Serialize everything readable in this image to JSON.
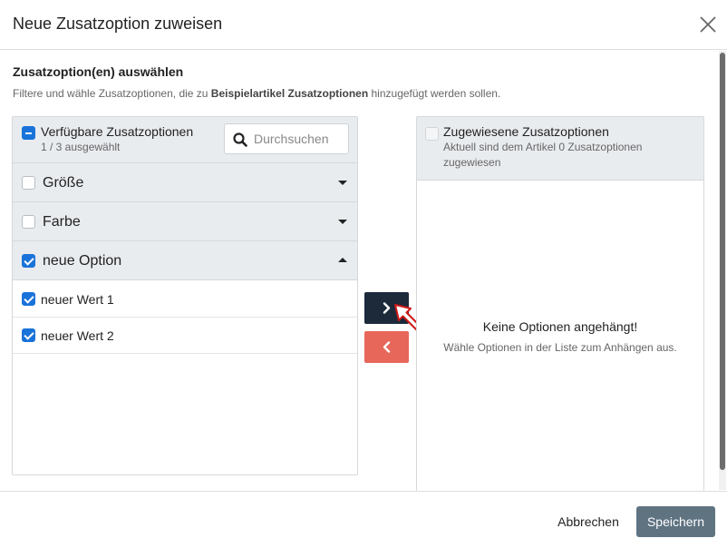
{
  "modal": {
    "title": "Neue Zusatzoption zuweisen",
    "close_icon": "close-icon"
  },
  "section": {
    "title": "Zusatzoption(en) auswählen",
    "desc_prefix": "Filtere und wähle Zusatzoptionen, die zu ",
    "desc_bold": "Beispielartikel Zusatzoptionen",
    "desc_suffix": " hinzugefügt werden sollen."
  },
  "available": {
    "title": "Verfügbare Zusatzoptionen",
    "count_text": "1 / 3 ausgewählt",
    "search_placeholder": "Durchsuchen",
    "search_value": "",
    "groups": [
      {
        "label": "Größe",
        "checked": false,
        "expanded": false
      },
      {
        "label": "Farbe",
        "checked": false,
        "expanded": false
      },
      {
        "label": "neue Option",
        "checked": true,
        "expanded": true,
        "values": [
          {
            "label": "neuer Wert 1",
            "checked": true
          },
          {
            "label": "neuer Wert 2",
            "checked": true
          }
        ]
      }
    ]
  },
  "assigned": {
    "title": "Zugewiesene Zusatzoptionen",
    "subtitle": "Aktuell sind dem Artikel 0 Zusatzoptionen zugewiesen",
    "empty_title": "Keine Optionen angehängt!",
    "empty_sub": "Wähle Optionen in der Liste zum Anhängen aus."
  },
  "transfer": {
    "add_icon": "chevron-right-icon",
    "remove_icon": "chevron-left-icon"
  },
  "footer": {
    "cancel_label": "Abbrechen",
    "save_label": "Speichern"
  },
  "colors": {
    "primary_dark": "#1c2a3a",
    "danger": "#e7675a",
    "checkbox_blue": "#1a73d9",
    "save_button": "#5f7381"
  }
}
